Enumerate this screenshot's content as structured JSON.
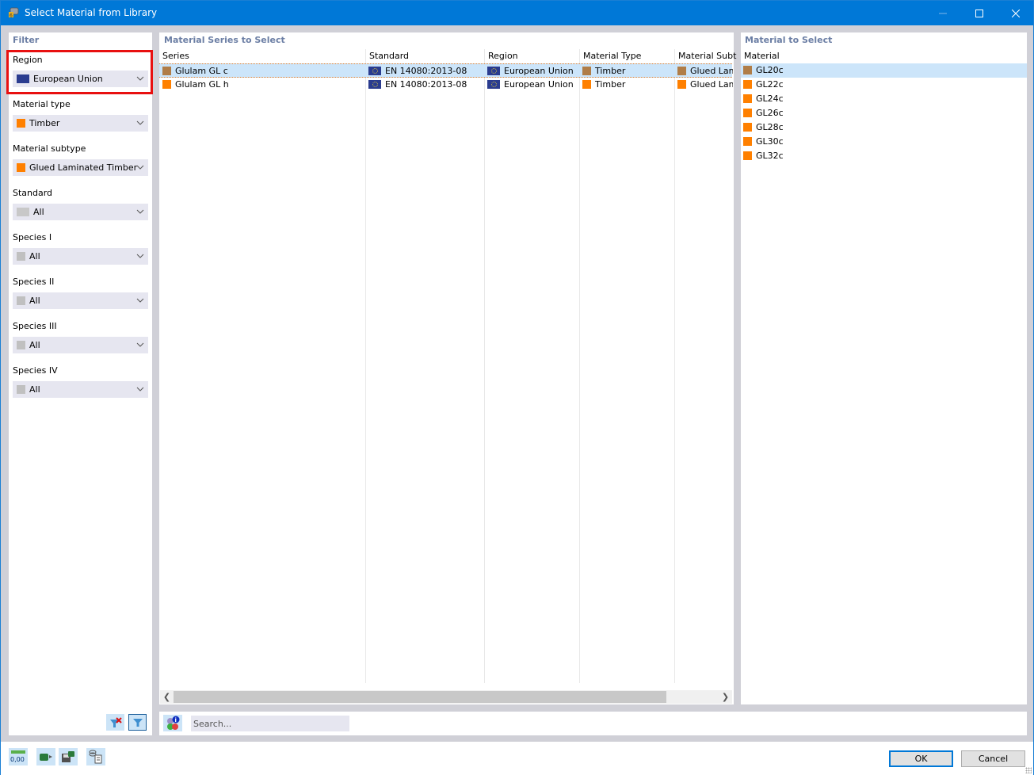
{
  "window": {
    "title": "Select Material from Library",
    "app_icon": "material-library-icon",
    "controls": [
      "minimize",
      "maximize",
      "close"
    ]
  },
  "filter": {
    "title": "Filter",
    "groups": [
      {
        "label": "Region",
        "value": "European Union",
        "icon": "eu-flag",
        "highlighted": true
      },
      {
        "label": "Material type",
        "value": "Timber",
        "icon": "orange-swatch"
      },
      {
        "label": "Material subtype",
        "value": "Glued Laminated Timber",
        "icon": "orange-swatch"
      },
      {
        "label": "Standard",
        "value": "All",
        "icon": "gray-swatch-wide"
      },
      {
        "label": "Species I",
        "value": "All",
        "icon": "gray-swatch"
      },
      {
        "label": "Species II",
        "value": "All",
        "icon": "gray-swatch"
      },
      {
        "label": "Species III",
        "value": "All",
        "icon": "gray-swatch"
      },
      {
        "label": "Species IV",
        "value": "All",
        "icon": "gray-swatch"
      }
    ],
    "buttons": {
      "clear_filter": "clear-filter-icon",
      "apply_filter": "filter-icon"
    }
  },
  "series": {
    "title": "Material Series to Select",
    "columns": [
      "Series",
      "Standard",
      "Region",
      "Material Type",
      "Material Subt"
    ],
    "rows": [
      {
        "series": "Glulam GL c",
        "standard": "EN 14080:2013-08",
        "region": "European Union",
        "type": "Timber",
        "subtype": "Glued Lam",
        "color": "#b07d48",
        "selected": true
      },
      {
        "series": "Glulam GL h",
        "standard": "EN 14080:2013-08",
        "region": "European Union",
        "type": "Timber",
        "subtype": "Glued Lam",
        "color": "#ff8000",
        "selected": false
      }
    ]
  },
  "search": {
    "placeholder": "Search..."
  },
  "material": {
    "title": "Material to Select",
    "column": "Material",
    "items": [
      {
        "name": "GL20c",
        "color": "#b07d48",
        "selected": true
      },
      {
        "name": "GL22c",
        "color": "#ff8000"
      },
      {
        "name": "GL24c",
        "color": "#ff8000"
      },
      {
        "name": "GL26c",
        "color": "#ff8000"
      },
      {
        "name": "GL28c",
        "color": "#ff8000"
      },
      {
        "name": "GL30c",
        "color": "#ff8000"
      },
      {
        "name": "GL32c",
        "color": "#ff8000"
      }
    ]
  },
  "footer": {
    "tools": [
      "units-decimal-icon",
      "import-icon",
      "save-icon",
      "database-report-icon"
    ],
    "units_label": "0,00",
    "ok_label": "OK",
    "cancel_label": "Cancel"
  },
  "colors": {
    "titlebar": "#0078d7",
    "selection": "#cce5fa",
    "highlight": "#e81010",
    "timber_brown": "#b07d48",
    "timber_orange": "#ff8000",
    "panel_title": "#6b7ea4"
  }
}
